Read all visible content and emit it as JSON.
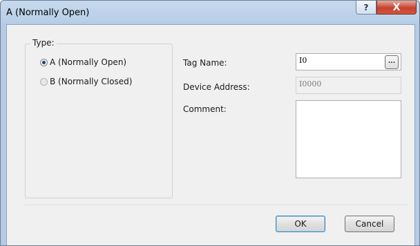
{
  "window": {
    "title": "A (Normally Open)"
  },
  "titlebar": {
    "help_glyph": "?",
    "close_glyph": "X",
    "help_icon": "help-icon",
    "close_icon": "close-icon"
  },
  "type_group": {
    "label": "Type:",
    "options": [
      {
        "label": "A (Normally Open)",
        "selected": true,
        "enabled": true
      },
      {
        "label": "B (Normally Closed)",
        "selected": false,
        "enabled": false
      }
    ]
  },
  "fields": {
    "tag_name": {
      "label": "Tag Name:",
      "value": "I0",
      "browse_label": "..."
    },
    "device_address": {
      "label": "Device Address:",
      "value": "I0000"
    },
    "comment": {
      "label": "Comment:",
      "value": ""
    }
  },
  "buttons": {
    "ok": "OK",
    "cancel": "Cancel"
  },
  "colors": {
    "title_bg": "#b9cfe8",
    "close_red": "#c7432f",
    "client_bg": "#f0f0f0"
  }
}
